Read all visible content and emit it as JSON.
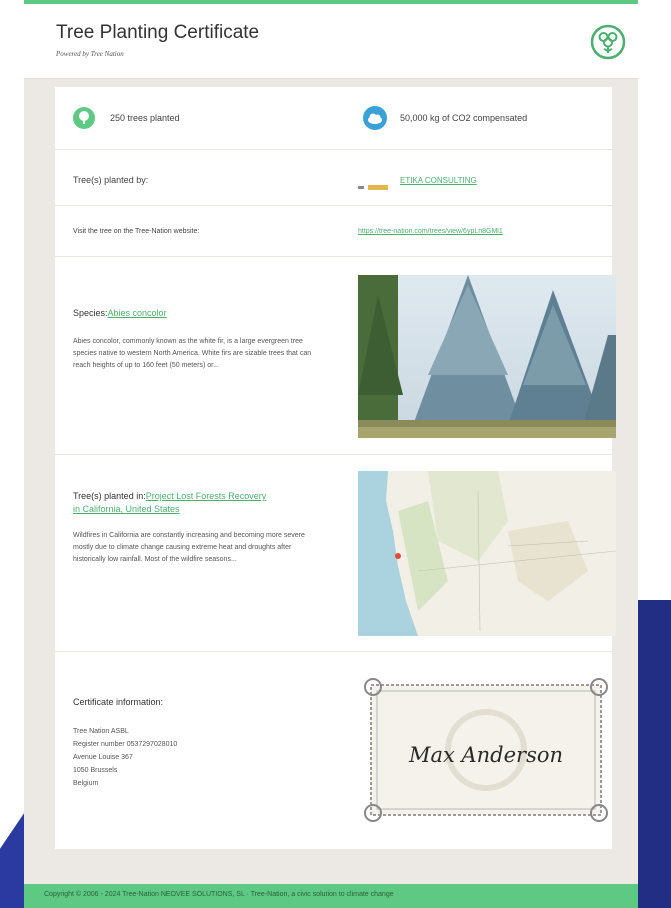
{
  "header": {
    "title": "Tree Planting Certificate",
    "subtitle": "Powered by Tree Nation",
    "logo_icon": "tree-nation-logo-icon"
  },
  "stats": {
    "trees": {
      "icon": "tree-icon",
      "text": "250 trees planted"
    },
    "co2": {
      "icon": "cloud-icon",
      "text": "50,000 kg of CO2 compensated"
    }
  },
  "planted_by": {
    "label": "Tree(s) planted by:",
    "company": "ETIKA CONSULTING"
  },
  "visit": {
    "label": "Visit the tree on the Tree-Nation website:",
    "url": "https://tree-nation.com/trees/view/6ypLn8GMl1"
  },
  "species": {
    "label": "Species:",
    "name": "Abies concolor",
    "description": "Abies concolor, commonly known as the white fir, is a large evergreen tree species native to western North America. White firs are sizable trees that can reach heights of up to 160 feet (50 meters) or..."
  },
  "project": {
    "label": "Tree(s) planted in:",
    "name": "Project Lost Forests Recovery in California, United States",
    "description": "Wildfires in California are constantly increasing and becoming more severe mostly due to climate change causing extreme heat and droughts after historically low rainfall. Most of the wildfire seasons..."
  },
  "certificate": {
    "heading": "Certificate information:",
    "lines": [
      "Tree Nation ASBL",
      "Register number 0537297028010",
      "Avenue Louise 367",
      "1050 Brussels",
      "Belgium"
    ],
    "signature": "Max Anderson"
  },
  "footer": {
    "text": "Copyright © 2006 - 2024 Tree-Nation NEOVEE SOLUTIONS, SL · Tree-Nation, a civic solution to climate change"
  },
  "colors": {
    "brand_green": "#5ec982",
    "link_green": "#4caf6e",
    "cloud_blue": "#3aa0d8"
  }
}
